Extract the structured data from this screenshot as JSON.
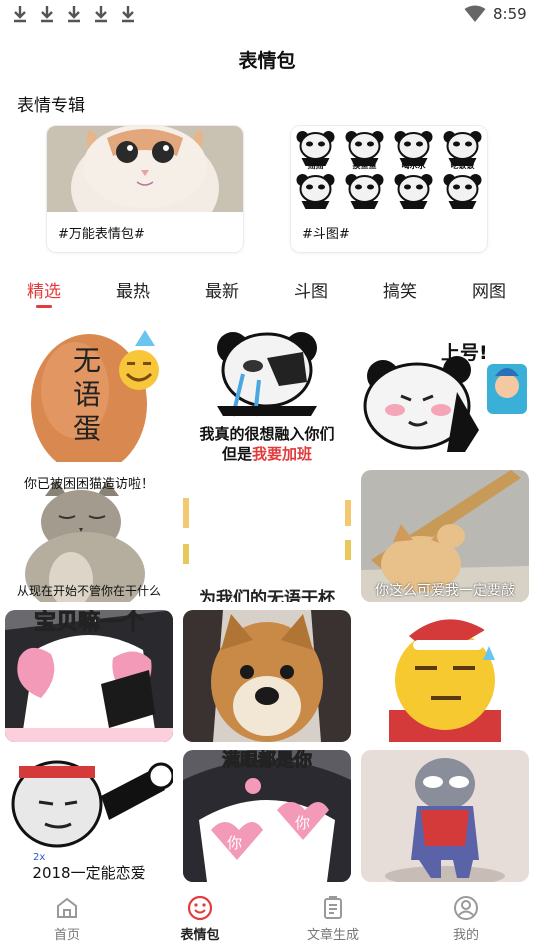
{
  "status_bar": {
    "time": "8:59"
  },
  "header": {
    "title": "表情包"
  },
  "albums_section": {
    "title": "表情专辑",
    "albums": [
      {
        "label": "#万能表情包#"
      },
      {
        "label": "#斗图#"
      }
    ],
    "album2_cells": [
      "摇摇",
      "摸鱼鱼",
      "喝水水",
      "吃饭饭"
    ]
  },
  "tabs": [
    {
      "label": "精选",
      "active": true
    },
    {
      "label": "最热",
      "active": false
    },
    {
      "label": "最新",
      "active": false
    },
    {
      "label": "斗图",
      "active": false
    },
    {
      "label": "搞笑",
      "active": false
    },
    {
      "label": "网图",
      "active": false
    }
  ],
  "stickers": {
    "s1": {
      "text": "无语蛋"
    },
    "s2": {
      "line1": "我真的很想融入你们",
      "line2_a": "但是",
      "line2_b": "我要加班"
    },
    "s3": {
      "text": "上号!"
    },
    "s4": {
      "top": "你已被困困猫造访啦！",
      "bottom": "从现在开始不管你在干什么"
    },
    "s5": {
      "bottom": "为我们的无语干杯"
    },
    "s6": {
      "caption": "你这么可爱我一定要敲"
    },
    "s7": {
      "top": "宝贝嘛一个"
    },
    "s10": {
      "caption": "2018一定能恋爱"
    },
    "s11": {
      "top": "满眼都是你",
      "heart_a": "你",
      "heart_b": "你"
    }
  },
  "accent_color": "#e23b3b",
  "bottom_nav": [
    {
      "label": "首页",
      "active": false,
      "icon": "home-icon"
    },
    {
      "label": "表情包",
      "active": true,
      "icon": "smile-icon"
    },
    {
      "label": "文章生成",
      "active": false,
      "icon": "document-icon"
    },
    {
      "label": "我的",
      "active": false,
      "icon": "user-icon"
    }
  ]
}
